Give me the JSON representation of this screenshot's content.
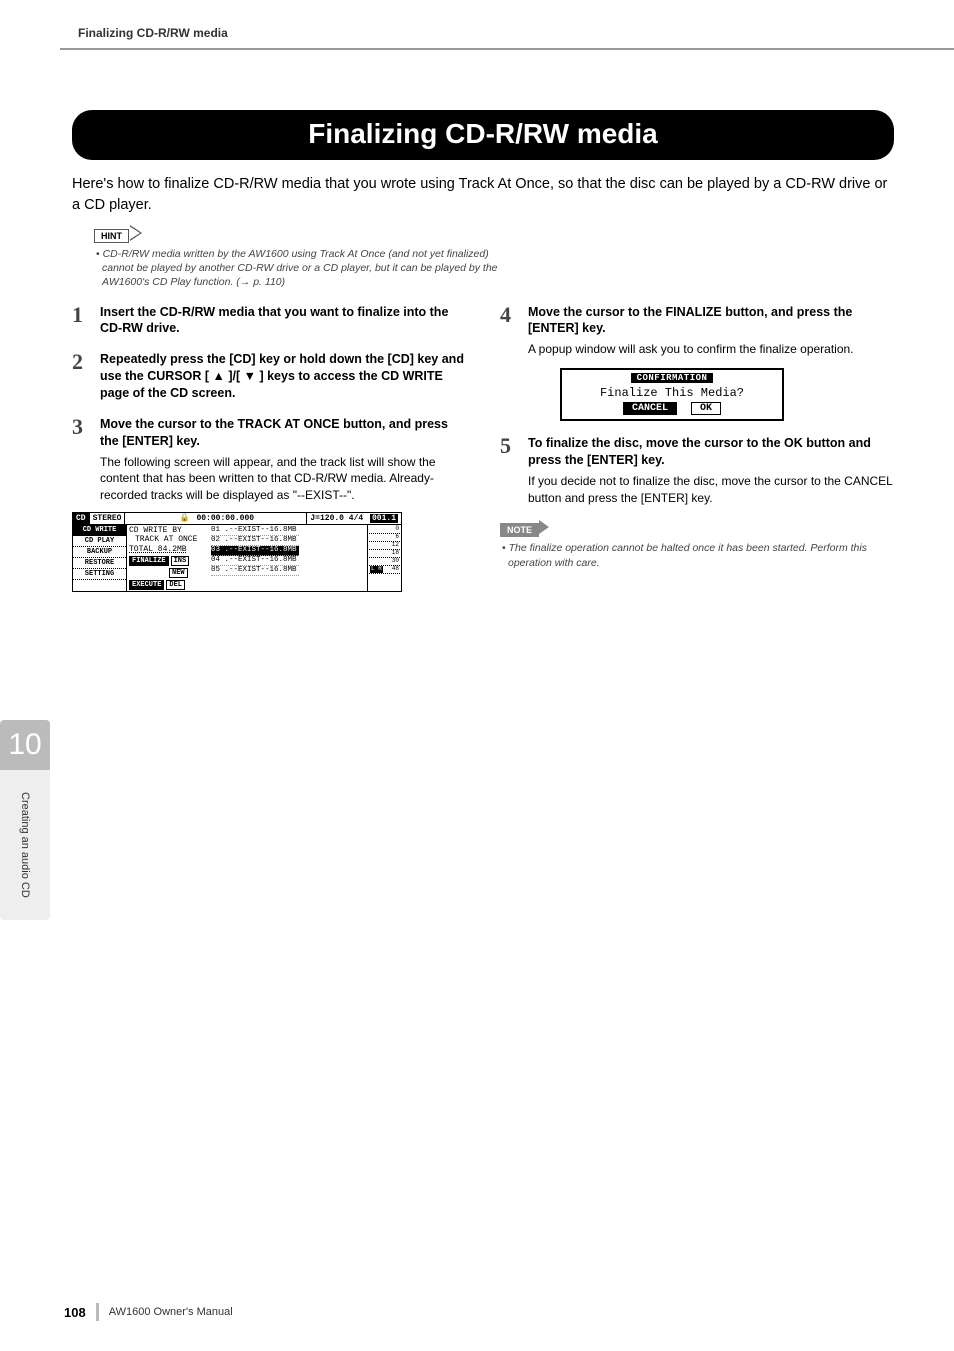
{
  "header": {
    "breadcrumb": "Finalizing CD-R/RW media"
  },
  "chapter": {
    "number": "10",
    "side_label": "Creating an audio CD"
  },
  "title": "Finalizing CD-R/RW media",
  "intro": "Here's how to finalize CD-R/RW media that you wrote using Track At Once, so that the disc can be played by a CD-RW drive or a CD player.",
  "hint": {
    "label": "HINT",
    "text": "CD-R/RW media written by the AW1600 using Track At Once (and not yet finalized) cannot be played by another CD-RW drive or a CD player, but it can be played by the AW1600's CD Play function. (→ p. 110)"
  },
  "steps_left": [
    {
      "num": "1",
      "title": "Insert the CD-R/RW media that you want to finalize into the CD-RW drive."
    },
    {
      "num": "2",
      "title": "Repeatedly press the [CD] key or hold down the [CD] key and use the CURSOR [ ▲ ]/[ ▼ ] keys to access the CD WRITE page of the CD screen."
    },
    {
      "num": "3",
      "title": "Move the cursor to the TRACK AT ONCE button, and press the [ENTER] key.",
      "body": "The following screen will appear, and the track list will show the content that has been written to that CD-R/RW media. Already-recorded tracks will be displayed as \"--EXIST--\"."
    }
  ],
  "steps_right": [
    {
      "num": "4",
      "title": "Move the cursor to the FINALIZE button, and press the [ENTER] key.",
      "body": "A popup window will ask you to confirm the finalize operation."
    },
    {
      "num": "5",
      "title": "To finalize the disc, move the cursor to the OK button and press the [ENTER] key.",
      "body": "If you decide not to finalize the disc, move the cursor to the CANCEL button and press the [ENTER] key."
    }
  ],
  "note": {
    "label": "NOTE",
    "text": "The finalize operation cannot be halted once it has been started. Perform this operation with care."
  },
  "cd_screen": {
    "top": {
      "cd": "CD",
      "mode": "STEREO",
      "lock": "🔒",
      "time": "00:00:00.000",
      "tempo": "J=120.0 4/4",
      "bar": "001.1"
    },
    "tabs": [
      "CD WRITE",
      "CD PLAY",
      "BACKUP",
      "RESTORE",
      "SETTING"
    ],
    "panel_lines": [
      "CD WRITE BY",
      "TRACK AT ONCE",
      "TOTAL 84.2MB"
    ],
    "buttons_row1": [
      "FINALIZE",
      "INS"
    ],
    "buttons_row2": [
      "NEW"
    ],
    "buttons_row3": [
      "EXECUTE",
      "DEL"
    ],
    "tracks": [
      "01 .--EXIST--16.8MB",
      "02 .--EXIST--16.8MB",
      "03 .--EXIST--16.8MB",
      "04 .--EXIST--16.8MB",
      "05 .--EXIST--16.8MB"
    ],
    "meter_marks": [
      "0",
      "6",
      "12",
      "18",
      "30",
      "48"
    ],
    "meter_label": "L R"
  },
  "confirm": {
    "titlebar": "CONFIRMATION",
    "message": "Finalize This Media?",
    "cancel": "CANCEL",
    "ok": "OK"
  },
  "footer": {
    "page": "108",
    "manual": "AW1600  Owner's Manual"
  }
}
